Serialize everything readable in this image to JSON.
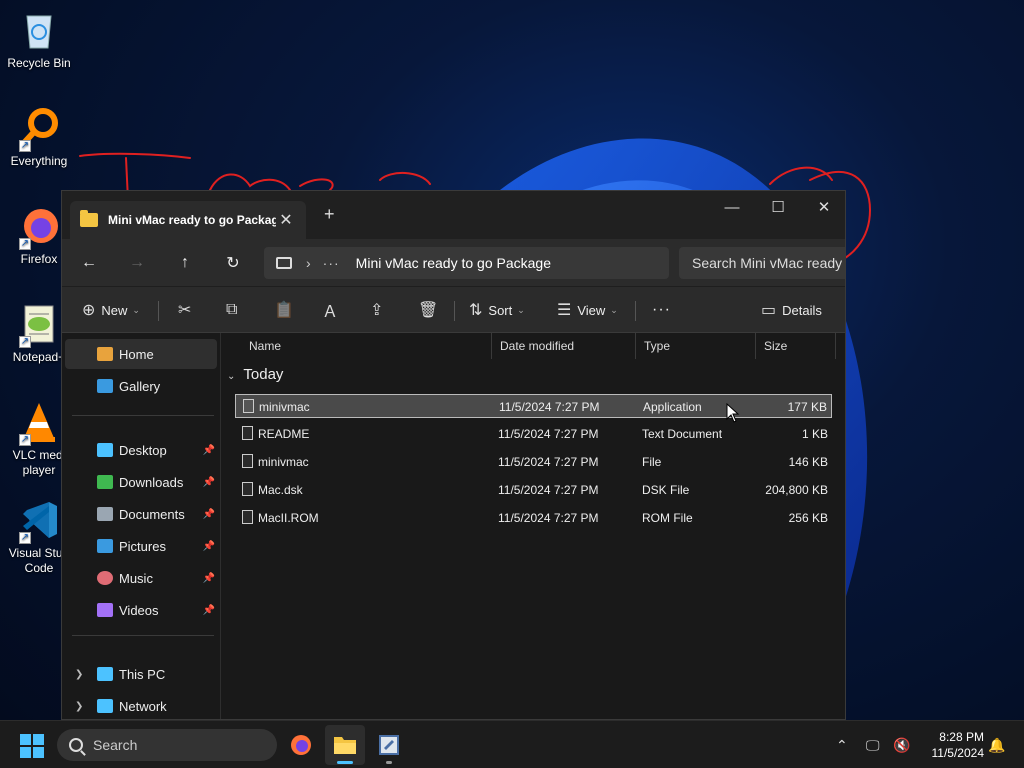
{
  "desktop": {
    "icons": [
      {
        "label": "Recycle Bin",
        "icon": "recycle-bin-icon"
      },
      {
        "label": "Everything",
        "icon": "everything-search-icon"
      },
      {
        "label": "Firefox",
        "icon": "firefox-icon"
      },
      {
        "label": "Notepad+",
        "icon": "notepad-plus-plus-icon"
      },
      {
        "label": "VLC media player",
        "label_line1": "VLC medi",
        "label_line2": "player",
        "icon": "vlc-icon"
      },
      {
        "label": "Visual Studio Code",
        "label_line1": "Visual Stud",
        "label_line2": "Code",
        "icon": "vscode-icon"
      }
    ]
  },
  "window": {
    "tab_title": "Mini vMac ready to go Packag",
    "tab_close": "✕",
    "new_tab": "+",
    "controls": {
      "minimize": "—",
      "maximize": "☐",
      "close": "✕"
    }
  },
  "address": {
    "path": "Mini vMac ready to go Package",
    "separator": "›",
    "ellipsis": "···",
    "search_placeholder": "Search Mini vMac ready t"
  },
  "toolbar": {
    "new_label": "New",
    "sort_label": "Sort",
    "view_label": "View",
    "more_label": "···",
    "details_label": "Details"
  },
  "sidebar": {
    "items": [
      {
        "label": "Home",
        "icon": "home-icon",
        "color": "#e8a33d"
      },
      {
        "label": "Gallery",
        "icon": "gallery-icon",
        "color": "#3a9ae0"
      },
      {
        "label": "Desktop",
        "icon": "desktop-icon",
        "color": "#4cc2ff"
      },
      {
        "label": "Downloads",
        "icon": "downloads-icon",
        "color": "#3fb950"
      },
      {
        "label": "Documents",
        "icon": "documents-icon",
        "color": "#9aa6b2"
      },
      {
        "label": "Pictures",
        "icon": "pictures-icon",
        "color": "#3a9ae0"
      },
      {
        "label": "Music",
        "icon": "music-icon",
        "color": "#e06c75"
      },
      {
        "label": "Videos",
        "icon": "videos-icon",
        "color": "#a371f7"
      },
      {
        "label": "This PC",
        "icon": "this-pc-icon",
        "color": "#4cc2ff"
      },
      {
        "label": "Network",
        "icon": "network-icon",
        "color": "#4cc2ff"
      }
    ],
    "pin": "📌"
  },
  "columns": {
    "name": "Name",
    "date": "Date modified",
    "type": "Type",
    "size": "Size"
  },
  "group": {
    "label": "Today"
  },
  "files": [
    {
      "name": "minivmac",
      "date": "11/5/2024 7:27 PM",
      "type": "Application",
      "size": "177 KB"
    },
    {
      "name": "README",
      "date": "11/5/2024 7:27 PM",
      "type": "Text Document",
      "size": "1 KB"
    },
    {
      "name": "minivmac",
      "date": "11/5/2024 7:27 PM",
      "type": "File",
      "size": "146 KB"
    },
    {
      "name": "Mac.dsk",
      "date": "11/5/2024 7:27 PM",
      "type": "DSK File",
      "size": "204,800 KB"
    },
    {
      "name": "MacII.ROM",
      "date": "11/5/2024 7:27 PM",
      "type": "ROM File",
      "size": "256 KB"
    }
  ],
  "taskbar": {
    "search_label": "Search",
    "time": "8:28 PM",
    "date": "11/5/2024",
    "accent": "#4cc2ff"
  }
}
